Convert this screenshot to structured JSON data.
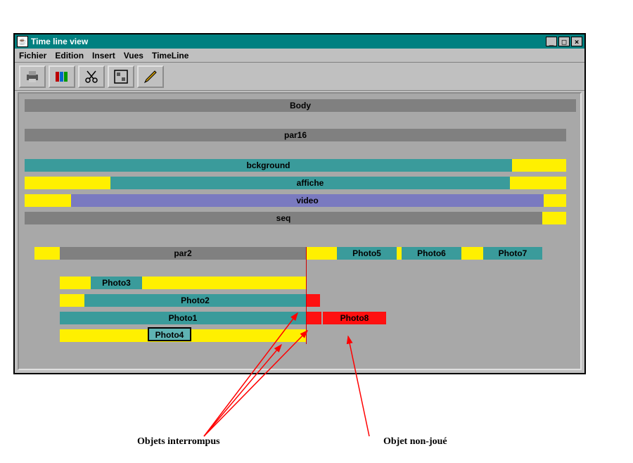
{
  "window": {
    "title": "Time line view"
  },
  "menu": {
    "items": [
      "Fichier",
      "Edition",
      "Insert",
      "Vues",
      "TimeLine"
    ]
  },
  "toolbar": {
    "icons": [
      "printer-icon",
      "books-icon",
      "scissors-icon",
      "layout-icon",
      "edit-icon"
    ]
  },
  "tracks": {
    "body": "Body",
    "par16": "par16",
    "bckground": "bckground",
    "affiche": "affiche",
    "video": "video",
    "seq": "seq",
    "par2": "par2",
    "photo5": "Photo5",
    "photo6": "Photo6",
    "photo7": "Photo7",
    "photo3": "Photo3",
    "photo2": "Photo2",
    "photo1": "Photo1",
    "photo8": "Photo8",
    "photo4": "Photo4"
  },
  "annotations": {
    "interrupted": "Objets interrompus",
    "nonplayed": "Objet non-joué"
  }
}
